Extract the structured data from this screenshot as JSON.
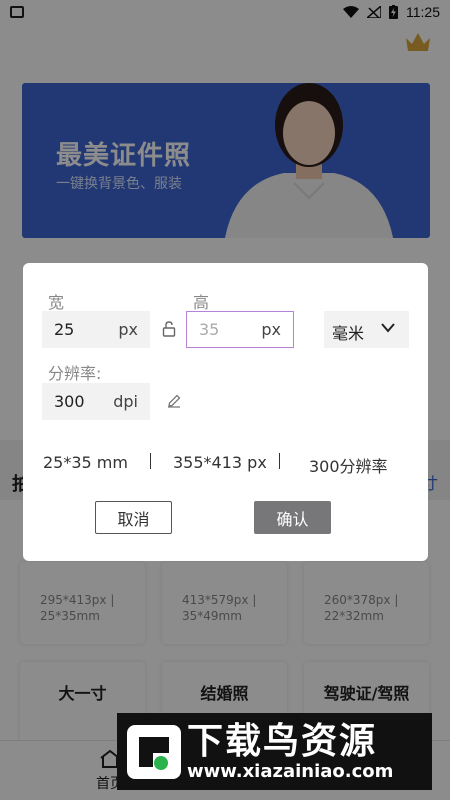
{
  "status_bar": {
    "time": "11:25"
  },
  "banner": {
    "title": "最美证件照",
    "subtitle": "一键换背景色、服装"
  },
  "background": {
    "tools_left": "拍",
    "tools_right": "寸",
    "cards": [
      {
        "spec_line1": "295*413px |",
        "spec_line2": "25*35mm"
      },
      {
        "spec_line1": "413*579px |",
        "spec_line2": "35*49mm"
      },
      {
        "spec_line1": "260*378px |",
        "spec_line2": "22*32mm"
      }
    ],
    "cards2": [
      {
        "title": "大一寸"
      },
      {
        "title": "结婚照"
      },
      {
        "title": "驾驶证/驾照"
      }
    ],
    "nav": {
      "home": "首页"
    }
  },
  "dialog": {
    "width_label": "宽",
    "height_label": "高",
    "width_value": "25",
    "width_unit": "px",
    "height_placeholder": "35",
    "height_unit": "px",
    "unit_select": "毫米",
    "dpi_label": "分辨率:",
    "dpi_value": "300",
    "dpi_unit": "dpi",
    "summary": {
      "mm": "25*35 mm",
      "px": "355*413 px",
      "dpi": "300分辨率"
    },
    "cancel": "取消",
    "confirm": "确认"
  },
  "watermark": {
    "title": "下载鸟资源",
    "url": "www.xiazainiao.com"
  },
  "colors": {
    "accent": "#3e67d6",
    "active_border": "#b883d6",
    "confirm_bg": "#777779"
  }
}
